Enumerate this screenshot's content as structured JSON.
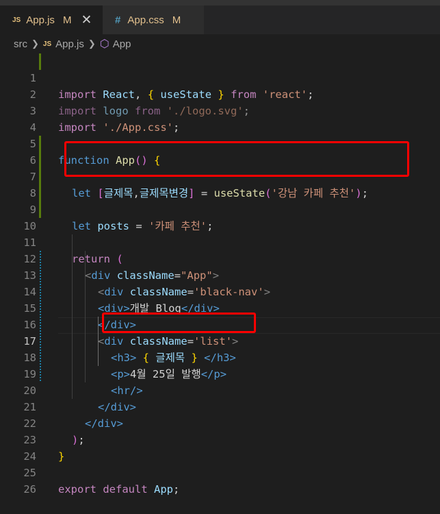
{
  "tabs": [
    {
      "icon": "JS",
      "name": "App.js",
      "modified": "M",
      "close": "✕"
    },
    {
      "icon": "#",
      "name": "App.css",
      "modified": "M"
    }
  ],
  "breadcrumb": {
    "folder": "src",
    "file_icon": "JS",
    "file": "App.js",
    "symbol": "App"
  },
  "line_numbers": [
    "1",
    "2",
    "3",
    "4",
    "5",
    "6",
    "7",
    "8",
    "9",
    "10",
    "11",
    "12",
    "13",
    "14",
    "15",
    "16",
    "17",
    "18",
    "19",
    "20",
    "21",
    "22",
    "23",
    "24",
    "25",
    "26"
  ],
  "code": {
    "l1": {
      "import": "import",
      "react": "React",
      "comma": ",",
      "ob": "{",
      "usestate": "useState",
      "cb": "}",
      "from": "from",
      "src": "'react'",
      "semi": ";"
    },
    "l2": {
      "import": "import",
      "logo": "logo",
      "from": "from",
      "src": "'./logo.svg'",
      "semi": ";"
    },
    "l3": {
      "import": "import",
      "src": "'./App.css'",
      "semi": ";"
    },
    "l5": {
      "function": "function",
      "name": "App",
      "paren": "()",
      "brace": "{"
    },
    "l7": {
      "let": "let",
      "ob": "[",
      "v1": "글제목",
      "comma": ",",
      "v2": "글제목변경",
      "cb": "]",
      "eq": "=",
      "fn": "useState",
      "op": "(",
      "str": "'강남 카페 추천'",
      "cp": ")",
      "semi": ";"
    },
    "l9": {
      "let": "let",
      "var": "posts",
      "eq": "=",
      "str": "'카페 추천'",
      "semi": ";"
    },
    "l11": {
      "return": "return",
      "paren": "("
    },
    "l12": {
      "lt": "<",
      "tag": "div",
      "attr": "className",
      "eq": "=",
      "val": "\"App\"",
      "gt": ">"
    },
    "l13": {
      "lt": "<",
      "tag": "div",
      "attr": "className",
      "eq": "=",
      "val": "'black-nav'",
      "gt": ">"
    },
    "l14": {
      "open": "<div>",
      "text": "개발 Blog",
      "close": "</div>"
    },
    "l15": {
      "close": "</div>"
    },
    "l16": {
      "lt": "<",
      "tag": "div",
      "attr": "className",
      "eq": "=",
      "val": "'list'",
      "gt": ">"
    },
    "l17": {
      "open": "<h3>",
      "ob": "{",
      "expr": "글제목",
      "cb": "}",
      "close": "</h3>"
    },
    "l18": {
      "open": "<p>",
      "text": "4월 25일 발행",
      "close": "</p>"
    },
    "l19": {
      "tag": "<hr/>"
    },
    "l20": {
      "close": "</div>"
    },
    "l21": {
      "close": "</div>"
    },
    "l22": {
      "paren": ")",
      "semi": ";"
    },
    "l23": {
      "brace": "}"
    },
    "l25": {
      "export": "export",
      "default": "default",
      "name": "App",
      "semi": ";"
    }
  },
  "colors": {
    "highlight_box": "#ff0000",
    "background": "#1e1e1e"
  }
}
